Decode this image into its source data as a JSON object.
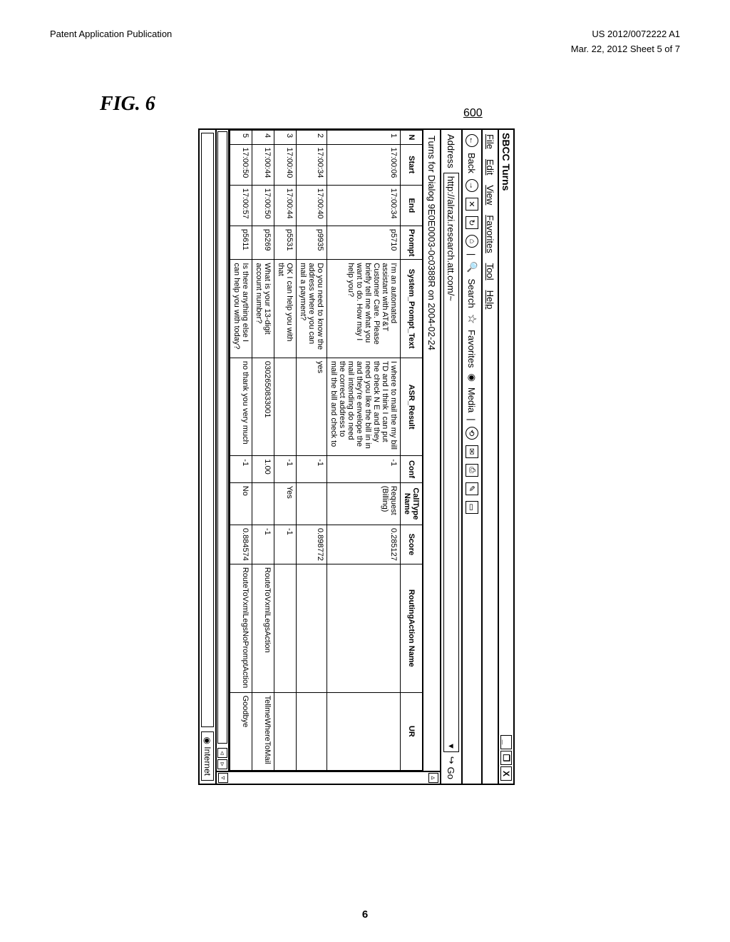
{
  "doc_header": {
    "left_top": "Patent Application Publication",
    "right_top": "Mar. 22, 2012  Sheet 5 of 7",
    "right_id": "US 2012/0072222 A1"
  },
  "figure_label": "FIG. 6",
  "ref_number": "600",
  "browser": {
    "title": "SBCC Turns",
    "win_min": "_",
    "win_max": "❐",
    "win_close": "X",
    "menu": [
      "File",
      "Edit",
      "View",
      "Favorites",
      "Tool",
      "Help"
    ],
    "toolbar": {
      "back": "Back",
      "search": "Search",
      "favorites": "Favorites",
      "media": "Media"
    },
    "address_label": "Address",
    "address_value": "http://alrazi.research.att.com/~",
    "go_label": "Go",
    "dialog_heading": "Turns for Dialog 9E0E0003-0c0388R on 2004-02-24",
    "columns": {
      "n": "N",
      "start": "Start",
      "end": "End",
      "prompt": "Prompt",
      "system_prompt": "System_Prompt_Text",
      "asr": "ASR_Result",
      "conf": "Conf",
      "calltype": "CallType Name",
      "score": "Score",
      "routing": "RoutingAction Name",
      "ur": "UR"
    },
    "rows": [
      {
        "n": "1",
        "start": "17:00:06",
        "end": "17:00:34",
        "prompt": "p5710",
        "system_prompt": "I'm an automated assistant with AT&T Customer Care. Please briefly tell me what you want to do. How may I help you?",
        "asr": "I where to mail the my bill TD and I think I can put the check N E and they need you like the bill in in and they're envelope the mail intending do need the correct address to mail the bill and check to",
        "conf": "-1",
        "calltype": "Request (Billing)",
        "score": "0.285127",
        "routing": "",
        "ur": ""
      },
      {
        "n": "2",
        "start": "17:00:34",
        "end": "17:00:40",
        "prompt": "p9935",
        "system_prompt": "Do you need to know the address where you can mail a payment?",
        "asr": "yes",
        "conf": "-1",
        "calltype": "",
        "score": "0.898772",
        "routing": "",
        "ur": ""
      },
      {
        "n": "3",
        "start": "17:00:40",
        "end": "17:00:44",
        "prompt": "p5531",
        "system_prompt": "OK I can help you with that",
        "asr": "",
        "conf": "-1",
        "calltype": "Yes",
        "score": "-1",
        "routing": "",
        "ur": ""
      },
      {
        "n": "4",
        "start": "17:00:44",
        "end": "17:00:50",
        "prompt": "p5269",
        "system_prompt": "What is your 13-digit account number?",
        "asr": "0302650833001",
        "conf": "1.00",
        "calltype": "",
        "score": "-1",
        "routing": "RouteToVxmlLegsAction",
        "ur": "TellmeWhereToMail"
      },
      {
        "n": "5",
        "start": "17:00:50",
        "end": "17:00:57",
        "prompt": "p5611",
        "system_prompt": "Is there anything else I can help you with today?",
        "asr": "no thank you very much",
        "conf": "-1",
        "calltype": "No",
        "score": "0.884574",
        "routing": "RouteToVxmlLegsNoPromptAction",
        "ur": "Goodbye"
      }
    ],
    "status_internet": "Internet"
  },
  "page_number": "6"
}
